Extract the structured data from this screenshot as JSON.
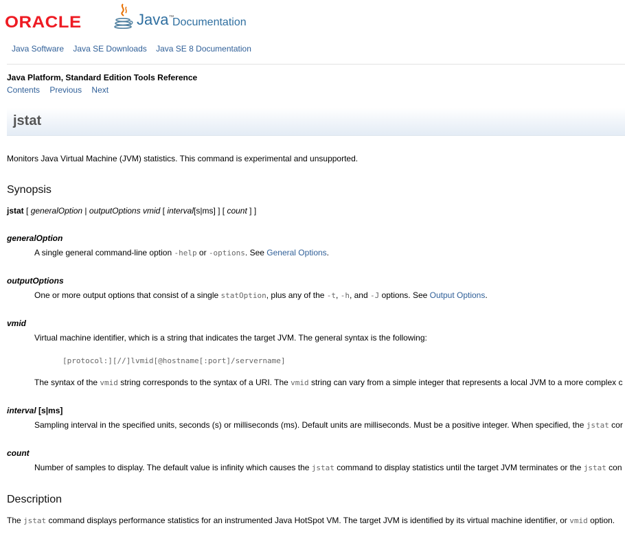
{
  "header": {
    "oracle_logo": "ORACLE",
    "java_word": "Java",
    "java_tm": "™",
    "documentation": "Documentation",
    "nav": [
      "Java Software",
      "Java SE Downloads",
      "Java SE 8 Documentation"
    ]
  },
  "book": {
    "title": "Java Platform, Standard Edition Tools Reference",
    "nav": [
      "Contents",
      "Previous",
      "Next"
    ]
  },
  "page": {
    "title": "jstat",
    "intro": "Monitors Java Virtual Machine (JVM) statistics. This command is experimental and unsupported."
  },
  "synopsis": {
    "heading": "Synopsis",
    "cmd": "jstat",
    "p1": " [ ",
    "generalOption": "generalOption",
    "p2": " | ",
    "outputOptions": "outputOptions",
    "p3": " ",
    "vmid": "vmid",
    "p4": " [ ",
    "interval": "interval",
    "p5": "[s|ms] ] [ ",
    "count": "count",
    "p6": " ] ]"
  },
  "terms": {
    "generalOption": {
      "term": "generalOption",
      "d1": "A single general command-line option ",
      "c1": "-help",
      "d2": " or ",
      "c2": "-options",
      "d3": ". See ",
      "link": "General Options",
      "d4": "."
    },
    "outputOptions": {
      "term": "outputOptions",
      "d1": "One or more output options that consist of a single ",
      "c1": "statOption",
      "d2": ", plus any of the ",
      "c2": "-t",
      "d3": ", ",
      "c3": "-h",
      "d4": ", and ",
      "c4": "-J",
      "d5": " options. See ",
      "link": "Output Options",
      "d6": "."
    },
    "vmid": {
      "term": "vmid",
      "d1": "Virtual machine identifier, which is a string that indicates the target JVM. The general syntax is the following:",
      "code": "[protocol:][//]lvmid[@hostname[:port]/servername]",
      "e1": "The syntax of the ",
      "c1": "vmid",
      "e2": " string corresponds to the syntax of a URI. The ",
      "c2": "vmid",
      "e3": " string can vary from a simple integer that represents a local JVM to a more complex c"
    },
    "interval": {
      "term": "interval",
      "suffix": " [s|ms]",
      "d1": "Sampling interval in the specified units, seconds (s) or milliseconds (ms). Default units are milliseconds. Must be a positive integer. When specified, the ",
      "c1": "jstat",
      "d2": " cor"
    },
    "count": {
      "term": "count",
      "d1": "Number of samples to display. The default value is infinity which causes the ",
      "c1": "jstat",
      "d2": " command to display statistics until the target JVM terminates or the ",
      "c2": "jstat",
      "d3": " con"
    }
  },
  "description": {
    "heading": "Description",
    "d1": "The ",
    "c1": "jstat",
    "d2": " command displays performance statistics for an instrumented Java HotSpot VM. The target JVM is identified by its virtual machine identifier, or ",
    "c2": "vmid",
    "d3": " option."
  },
  "colors": {
    "link": "#2f5f98",
    "oracle_red": "#ee1b23",
    "java_blue": "#2f6fa0",
    "title_bar": "#e4ecf5"
  }
}
